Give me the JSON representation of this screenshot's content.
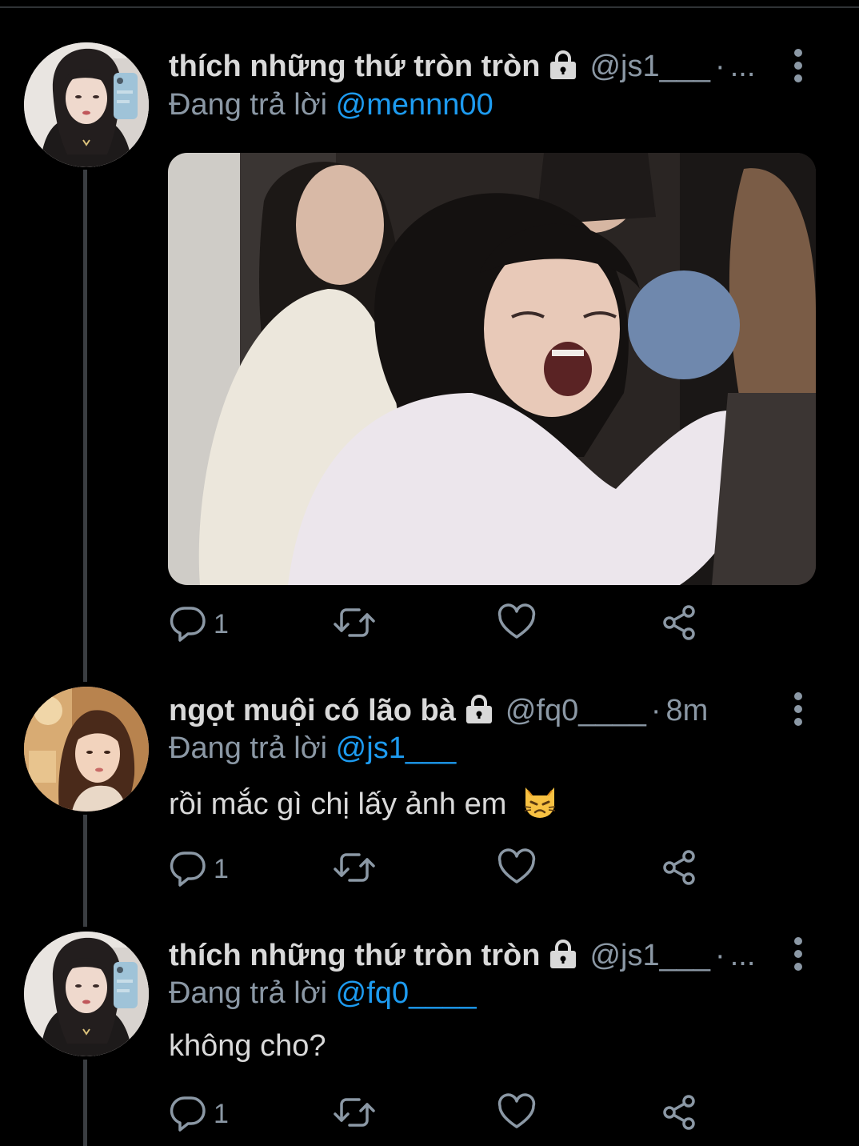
{
  "colors": {
    "background": "#000000",
    "text": "#d9d9d9",
    "secondary": "#8b98a5",
    "accent": "#1d9bf0",
    "thread_line": "#3a3d41"
  },
  "tweets": [
    {
      "display_name": "thích những thứ tròn tròn",
      "locked": true,
      "handle": "@js1___",
      "separator": "·",
      "time": "...",
      "reply_prefix": "Đang trả lời ",
      "reply_to": "@mennn00",
      "text": "",
      "has_media": true,
      "reply_count": "1"
    },
    {
      "display_name": "ngọt muội có lão bà",
      "locked": true,
      "handle": "@fq0____",
      "separator": "·",
      "time": "8m",
      "reply_prefix": "Đang trả lời ",
      "reply_to": "@js1___",
      "text": "rồi mắc gì chị lấy ảnh em",
      "emoji": "pouting-cat-emoji",
      "has_media": false,
      "reply_count": "1"
    },
    {
      "display_name": "thích những thứ tròn tròn",
      "locked": true,
      "handle": "@js1___",
      "separator": "·",
      "time": "...",
      "reply_prefix": "Đang trả lời ",
      "reply_to": "@fq0____",
      "text": "không cho?",
      "has_media": false,
      "reply_count": "1"
    }
  ],
  "icons": {
    "reply": "reply-icon",
    "retweet": "retweet-icon",
    "like": "heart-icon",
    "share": "share-icon",
    "more": "more-vertical-icon",
    "lock": "lock-icon"
  }
}
